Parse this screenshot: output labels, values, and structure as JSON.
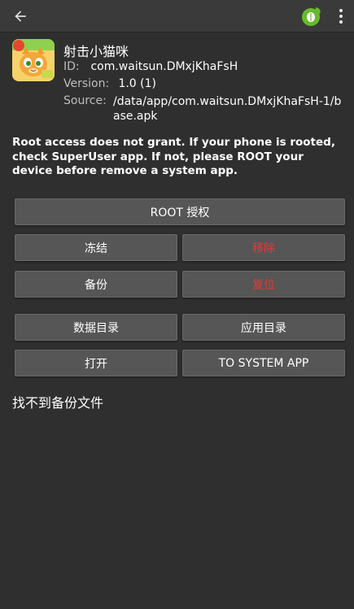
{
  "toolbar": {
    "back_icon": "arrow-left-icon",
    "leaf_icon": "leaf-icon",
    "leaf_color": "#66bb2a",
    "more_icon": "more-vertical-icon"
  },
  "app": {
    "icon": "cat-app-icon",
    "name": "射击小猫咪",
    "id_label": "ID:",
    "id_value": "com.waitsun.DMxjKhaFsH",
    "version_label": "Version:",
    "version_value": "1.0 (1)",
    "source_label": "Source:",
    "source_value": "/data/app/com.waitsun.DMxjKhaFsH-1/base.apk"
  },
  "warning": "Root access does not grant. If your phone is rooted, check SuperUser app. If not, please ROOT your device before remove a system app.",
  "buttons": {
    "root": "ROOT 授权",
    "freeze": "冻结",
    "remove": "移除",
    "backup": "备份",
    "restore": "复位",
    "data_dir": "数据目录",
    "app_dir": "应用目录",
    "open": "打开",
    "to_system": "TO SYSTEM APP"
  },
  "colors": {
    "background": "#2f2f2f",
    "toolbar": "#3a3a3a",
    "button": "#565656",
    "danger": "#e53935"
  },
  "status": {
    "no_backup": "找不到备份文件"
  }
}
